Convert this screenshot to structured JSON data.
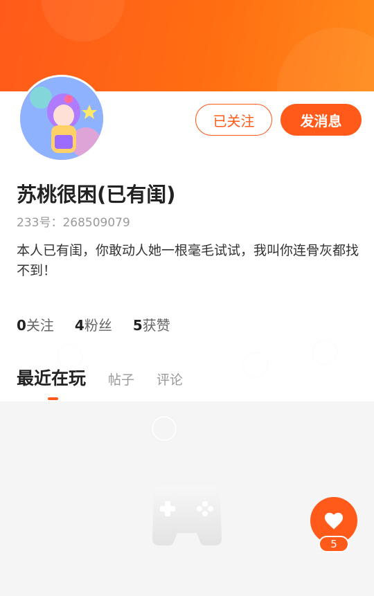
{
  "profile": {
    "nickname": "苏桃很困(已有闺)",
    "uid": "233号：268509079",
    "bio": "本人已有闺，你敢动人她一根毫毛试试，我叫你连骨灰都找不到！"
  },
  "actions": {
    "follow_label": "已关注",
    "message_label": "发消息"
  },
  "stats": [
    {
      "num": "0",
      "label": "关注"
    },
    {
      "num": "4",
      "label": "粉丝"
    },
    {
      "num": "5",
      "label": "获赞"
    }
  ],
  "tabs": [
    {
      "label": "最近在玩",
      "active": true
    },
    {
      "label": "帖子",
      "active": false
    },
    {
      "label": "评论",
      "active": false
    }
  ],
  "like": {
    "count": "5"
  },
  "colors": {
    "accent": "#ff5a1a",
    "background": "#f5f5f5"
  },
  "icons": {
    "empty_state": "gamepad-icon",
    "like": "heart-icon"
  }
}
